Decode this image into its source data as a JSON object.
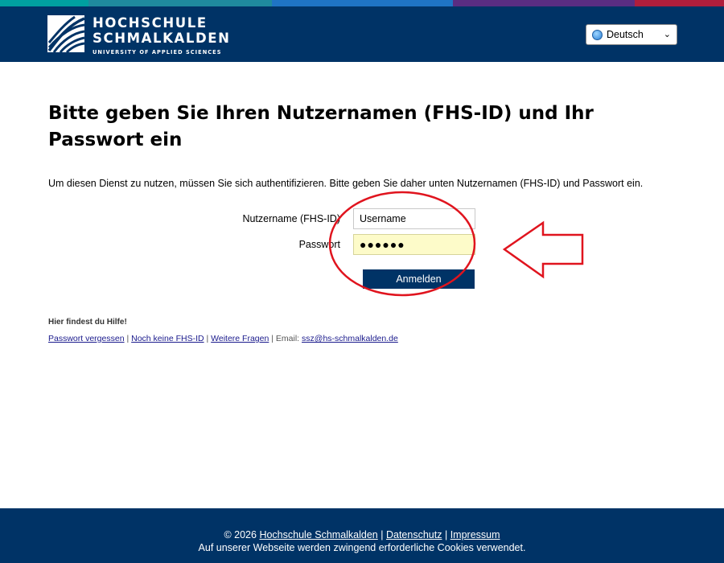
{
  "colors": {
    "brand_navy": "#003366",
    "accent_bar": [
      "#00a0a0",
      "#1f74c4",
      "#5a2d82",
      "#b01e3c"
    ],
    "password_bg": "#fdfbc9",
    "annotation_red": "#e0141e"
  },
  "header": {
    "logo_line1": "HOCHSCHULE",
    "logo_line2": "SCHMALKALDEN",
    "logo_line3": "UNIVERSITY OF APPLIED SCIENCES",
    "language_selected": "Deutsch"
  },
  "main": {
    "title": "Bitte geben Sie Ihren Nutzernamen (FHS-ID) und Ihr Passwort ein",
    "intro": "Um diesen Dienst zu nutzen, müssen Sie sich authentifizieren. Bitte geben Sie daher unten Nutzernamen (FHS-ID) und Passwort ein.",
    "username_label": "Nutzername (FHS-ID)",
    "username_value": "Username",
    "password_label": "Passwort",
    "password_value": "●●●●●●",
    "login_button": "Anmelden"
  },
  "help": {
    "title": "Hier findest du Hilfe!",
    "link_forgot": "Passwort vergessen",
    "link_no_id": "Noch keine FHS-ID",
    "link_more": "Weitere Fragen",
    "email_label": "Email:",
    "email": "ssz@hs-schmalkalden.de"
  },
  "footer": {
    "copyright": "© 2026",
    "link_school": "Hochschule Schmalkalden",
    "link_privacy": "Datenschutz",
    "link_imprint": "Impressum",
    "cookie_notice": "Auf unserer Webseite werden zwingend erforderliche Cookies verwendet."
  }
}
